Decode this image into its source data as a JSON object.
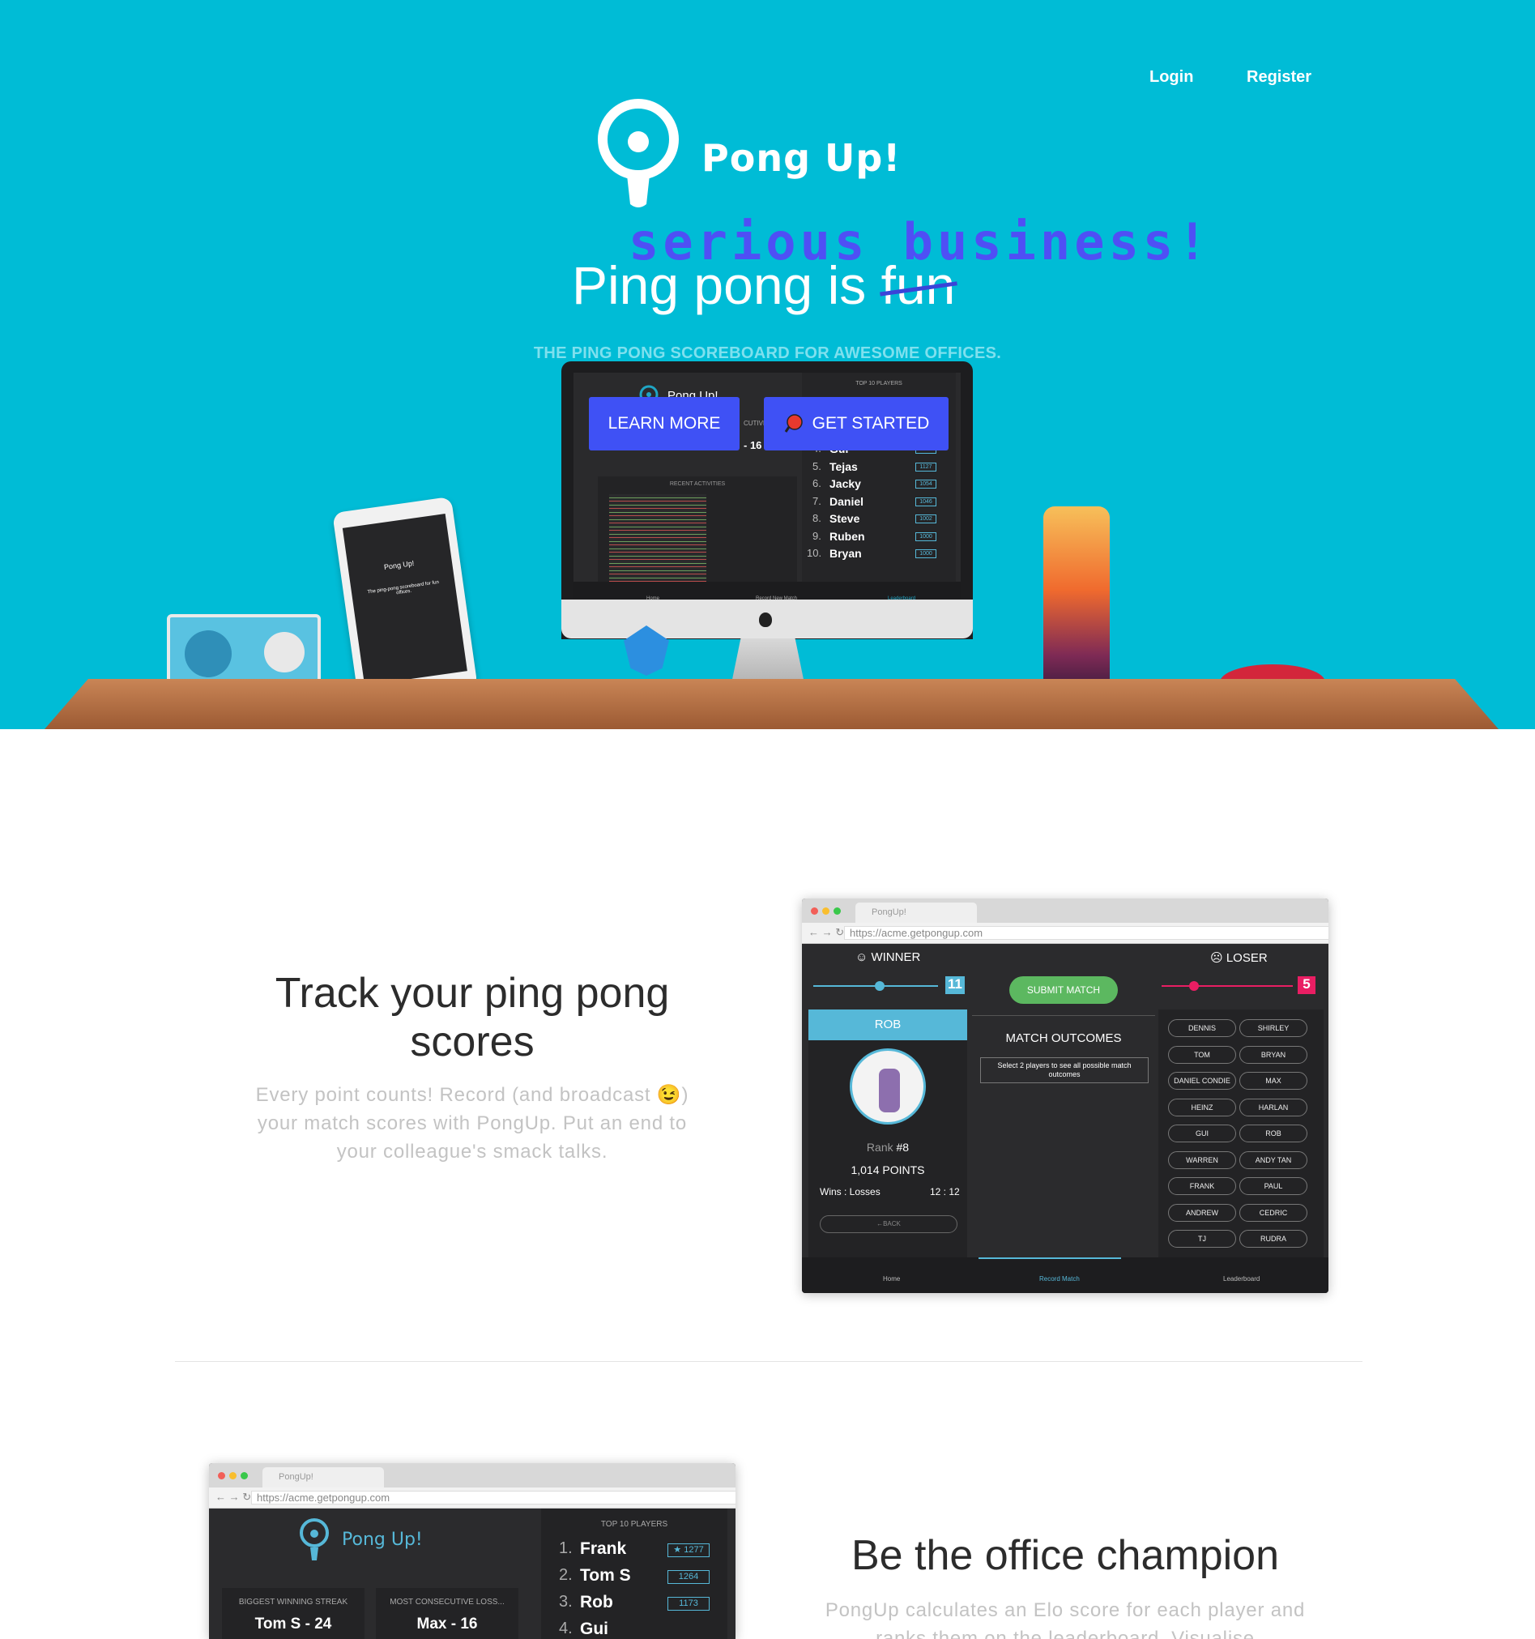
{
  "nav": {
    "login": "Login",
    "register": "Register"
  },
  "brand": {
    "name": "Pong Up!"
  },
  "hero": {
    "handwritten": "serious business!",
    "headline_prefix": "Ping pong is ",
    "headline_struck": "fun",
    "tagline": "THE PING PONG SCOREBOARD FOR AWESOME OFFICES.",
    "learn_more": "LEARN MORE",
    "get_started": "GET STARTED"
  },
  "monitor": {
    "logo": "Pong Up!",
    "top10_title": "TOP 10 PLAYERS",
    "streak_fragment": "CUTIVE L",
    "streak_value": "- 16",
    "recent_title": "RECENT ACTIVITIES",
    "players": [
      {
        "rank": "4.",
        "name": "Gui",
        "score": "1139"
      },
      {
        "rank": "5.",
        "name": "Tejas",
        "score": "1127"
      },
      {
        "rank": "6.",
        "name": "Jacky",
        "score": "1054"
      },
      {
        "rank": "7.",
        "name": "Daniel",
        "score": "1046"
      },
      {
        "rank": "8.",
        "name": "Steve",
        "score": "1002"
      },
      {
        "rank": "9.",
        "name": "Ruben",
        "score": "1000"
      },
      {
        "rank": "10.",
        "name": "Bryan",
        "score": "1000"
      }
    ],
    "footer": [
      "Home",
      "Record New Match",
      "Leaderboard"
    ]
  },
  "tablet": {
    "logo": "Pong Up!",
    "text": "The ping-pong scoreboard for fun offices."
  },
  "section1": {
    "title": "Track your ping pong scores",
    "body": "Every point counts! Record (and broadcast 😉) your match scores with PongUp. Put an end to your colleague's smack talks."
  },
  "shot1": {
    "tab": "PongUp!",
    "url": "https://acme.getpongup.com",
    "winner": "WINNER",
    "loser": "LOSER",
    "winner_score": "11",
    "loser_score": "5",
    "submit": "SUBMIT MATCH",
    "player": "ROB",
    "outcomes_title": "MATCH OUTCOMES",
    "outcomes_hint": "Select 2 players to see all possible match outcomes",
    "rank_label": "Rank",
    "rank": "#8",
    "points": "1,014 POINTS",
    "wl_label": "Wins : Losses",
    "wl": "12 : 12",
    "back": "←BACK",
    "players": [
      "DENNIS",
      "SHIRLEY",
      "TOM",
      "BRYAN",
      "DANIEL CONDIE",
      "MAX",
      "HEINZ",
      "HARLAN",
      "GUI",
      "ROB",
      "WARREN",
      "ANDY TAN",
      "FRANK",
      "PAUL",
      "ANDREW",
      "CEDRIC",
      "TJ",
      "RUDRA"
    ],
    "footer": [
      "Home",
      "Record Match",
      "Leaderboard"
    ]
  },
  "shot2": {
    "tab": "PongUp!",
    "url": "https://acme.getpongup.com",
    "logo": "Pong Up!",
    "top10_title": "TOP 10 PLAYERS",
    "streak_label": "BIGGEST WINNING STREAK",
    "streak_value": "Tom S - 24",
    "loss_label": "MOST CONSECUTIVE LOSS...",
    "loss_value": "Max - 16",
    "players": [
      {
        "rank": "1.",
        "name": "Frank",
        "score": "★ 1277"
      },
      {
        "rank": "2.",
        "name": "Tom S",
        "score": "1264"
      },
      {
        "rank": "3.",
        "name": "Rob",
        "score": "1173"
      },
      {
        "rank": "4.",
        "name": "Gui",
        "score": ""
      }
    ]
  },
  "section2": {
    "title": "Be the office champion",
    "body": "PongUp calculates an Elo score for each player and ranks them on the leaderboard. Visualise"
  },
  "colors": {
    "hero_bg": "#00bcd6",
    "button": "#3f51f5",
    "handwritten": "#4f4ff5"
  }
}
